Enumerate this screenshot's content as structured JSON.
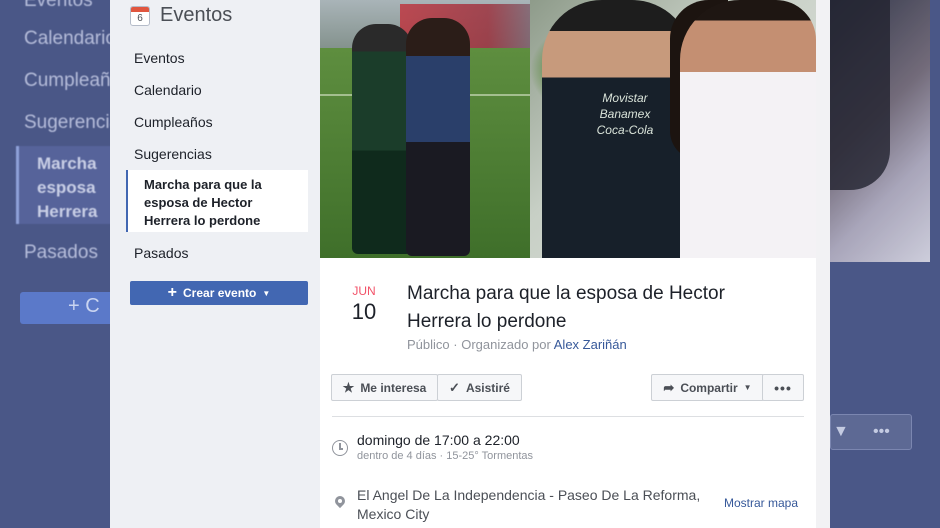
{
  "background": {
    "left_items": [
      "Eventos",
      "Calendario",
      "Cumpleaños",
      "Sugerencias"
    ],
    "left_selected": [
      "Marcha",
      "esposa",
      "Herrera"
    ],
    "left_past": "Pasados",
    "left_button": "+ C",
    "right_more": "•••",
    "right_caret": "▼"
  },
  "sidebar": {
    "calendar_day": "6",
    "title": "Eventos",
    "items": [
      {
        "label": "Eventos"
      },
      {
        "label": "Calendario"
      },
      {
        "label": "Cumpleaños"
      },
      {
        "label": "Sugerencias"
      }
    ],
    "selected_lines": [
      "Marcha para que la",
      "esposa de Hector",
      "Herrera lo perdone"
    ],
    "past": "Pasados",
    "create_button": {
      "plus": "+",
      "label": "Crear evento",
      "caret": "▼"
    }
  },
  "cover": {
    "shirt_text": [
      "Movistar",
      "Banamex",
      "Coca-Cola"
    ]
  },
  "event": {
    "month": "JUN",
    "day": "10",
    "title": "Marcha para que la esposa de Hector Herrera lo perdone",
    "privacy": "Público",
    "separator": "·",
    "organized_by": "Organizado por",
    "organizer": "Alex Zariñán"
  },
  "actions": {
    "interest": {
      "icon": "★",
      "label": "Me interesa"
    },
    "attend": {
      "icon": "✓",
      "label": "Asistiré"
    },
    "share": {
      "icon": "➦",
      "label": "Compartir",
      "caret": "▼"
    },
    "more": "•••"
  },
  "details": {
    "when": "domingo de 17:00 a 22:00",
    "when_sub": "dentro de 4 días · 15-25° Tormentas",
    "where": "El Angel De La Independencia - Paseo De La Reforma, Mexico City",
    "map_link": "Mostrar mapa"
  },
  "colors": {
    "accent": "#4267b2",
    "link": "#365899",
    "month_red": "#f25268"
  }
}
